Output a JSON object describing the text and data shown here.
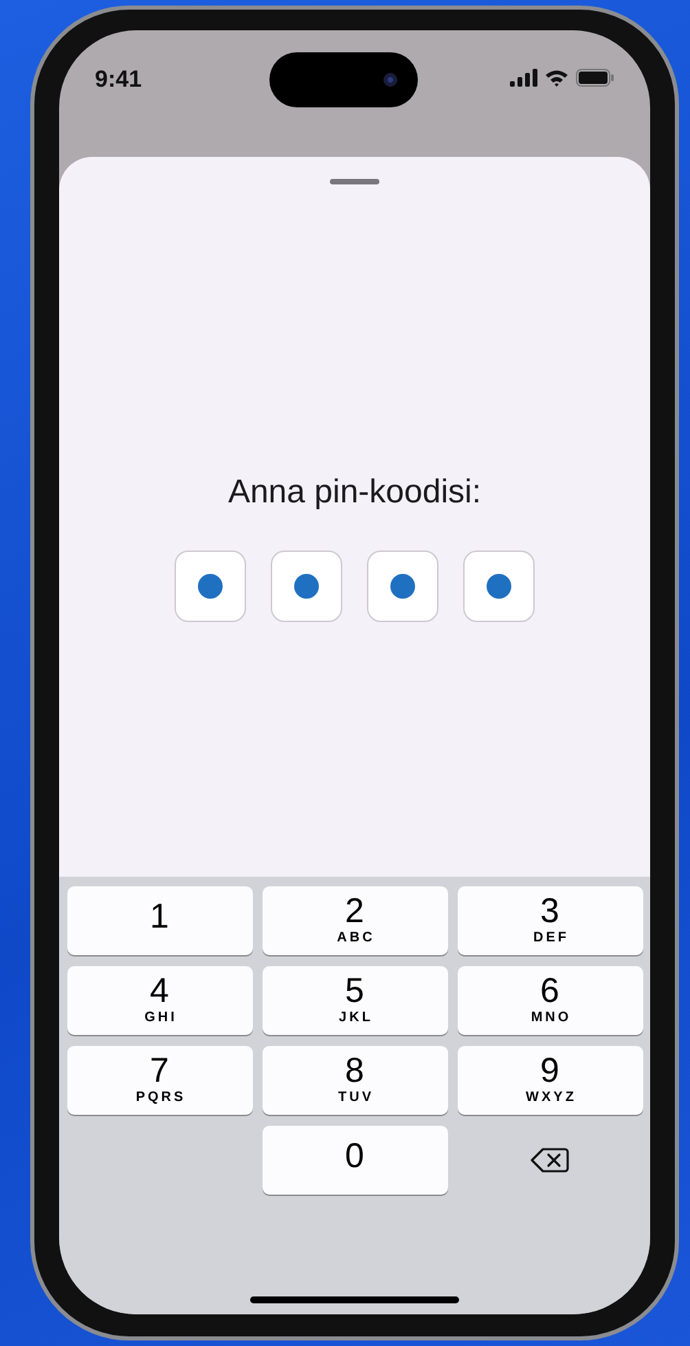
{
  "status_bar": {
    "time": "9:41"
  },
  "pin": {
    "title": "Anna pin-koodisi:",
    "digits": [
      {
        "filled": true
      },
      {
        "filled": true
      },
      {
        "filled": true
      },
      {
        "filled": true
      }
    ]
  },
  "keypad": [
    {
      "kind": "key",
      "digit": "1"
    },
    {
      "kind": "key",
      "digit": "2",
      "letters": "ABC"
    },
    {
      "kind": "key",
      "digit": "3",
      "letters": "DEF"
    },
    {
      "kind": "key",
      "digit": "4",
      "letters": "GHI"
    },
    {
      "kind": "key",
      "digit": "5",
      "letters": "JKL"
    },
    {
      "kind": "key",
      "digit": "6",
      "letters": "MNO"
    },
    {
      "kind": "key",
      "digit": "7",
      "letters": "PQRS"
    },
    {
      "kind": "key",
      "digit": "8",
      "letters": "TUV"
    },
    {
      "kind": "key",
      "digit": "9",
      "letters": "WXYZ"
    },
    {
      "kind": "blank"
    },
    {
      "kind": "key",
      "digit": "0"
    },
    {
      "kind": "delete"
    }
  ]
}
